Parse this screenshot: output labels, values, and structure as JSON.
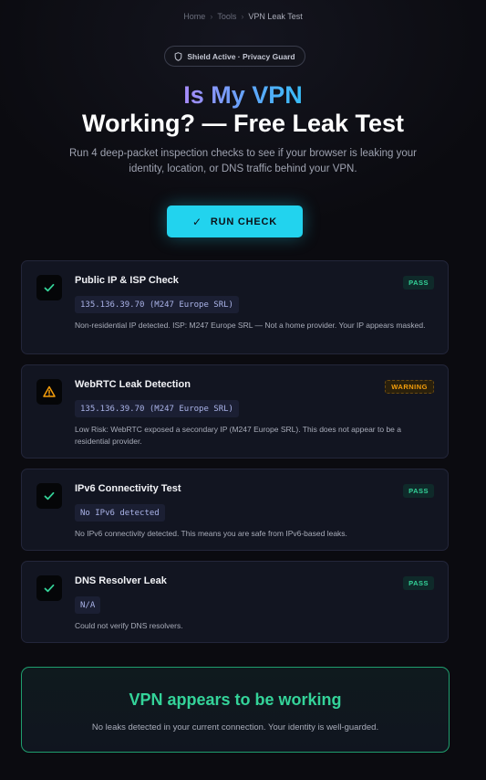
{
  "breadcrumb": {
    "home": "Home",
    "tools": "Tools",
    "current": "VPN Leak Test"
  },
  "badge": {
    "label": "Shield Active · Privacy Guard",
    "icon": "shield-icon"
  },
  "hero": {
    "title_line1": "Is My VPN",
    "title_line2": "Working? — Free Leak Test",
    "subtitle": "Run 4 deep-packet inspection checks to see if your browser is leaking your identity, location, or DNS traffic behind your VPN."
  },
  "run_button": {
    "label": "RUN CHECK",
    "icon": "check-icon"
  },
  "checks": [
    {
      "title": "Public IP & ISP Check",
      "status": "PASS",
      "value": "135.136.39.70 (M247 Europe SRL)",
      "description": "Non-residential IP detected. ISP: M247 Europe SRL — Not a home provider. Your IP appears masked.",
      "icon": "check-icon"
    },
    {
      "title": "WebRTC Leak Detection",
      "status": "WARNING",
      "value": "135.136.39.70 (M247 Europe SRL)",
      "description": "Low Risk: WebRTC exposed a secondary IP (M247 Europe SRL). This does not appear to be a residential provider.",
      "icon": "warning-icon"
    },
    {
      "title": "IPv6 Connectivity Test",
      "status": "PASS",
      "value": "No IPv6 detected",
      "description": "No IPv6 connectivity detected. This means you are safe from IPv6-based leaks.",
      "icon": "check-icon"
    },
    {
      "title": "DNS Resolver Leak",
      "status": "PASS",
      "value": "N/A",
      "description": "Could not verify DNS resolvers.",
      "icon": "check-icon"
    }
  ],
  "summary": {
    "title": "VPN appears to be working",
    "description": "No leaks detected in your current connection. Your identity is well-guarded."
  },
  "colors": {
    "accent": "#22d3ee",
    "pass": "#34d399",
    "warning": "#f59e0b",
    "background": "#0b0b10"
  }
}
